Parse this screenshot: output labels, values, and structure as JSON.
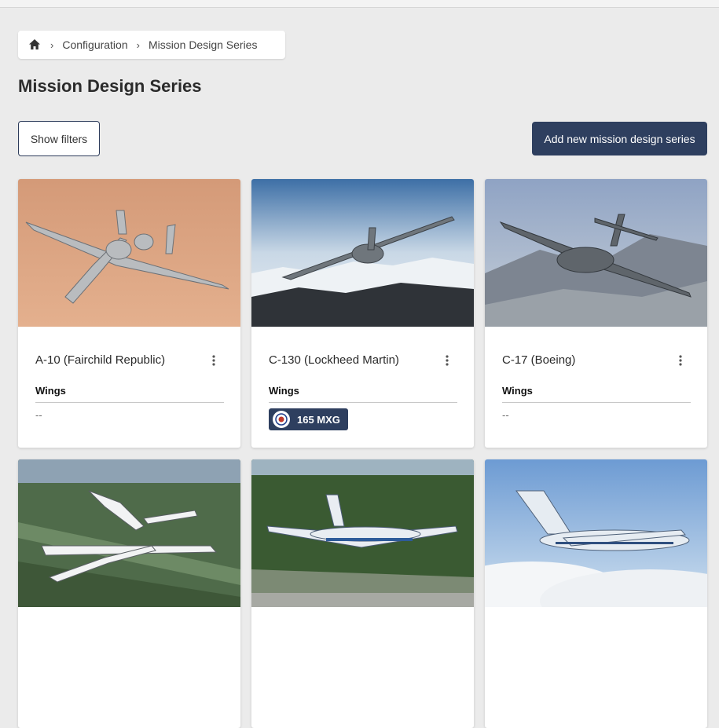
{
  "breadcrumb": {
    "items": [
      "Configuration",
      "Mission Design Series"
    ]
  },
  "page": {
    "title": "Mission Design Series",
    "show_filters_label": "Show filters",
    "add_label": "Add new mission design series"
  },
  "cards": [
    {
      "name": "A-10 (Fairchild Republic)",
      "wings_label": "Wings",
      "wings_empty": "--"
    },
    {
      "name": "C-130 (Lockheed Martin)",
      "wings_label": "Wings",
      "wing_badge": "165 MXG"
    },
    {
      "name": "C-17 (Boeing)",
      "wings_label": "Wings",
      "wings_empty": "--"
    },
    {
      "name": ""
    },
    {
      "name": ""
    },
    {
      "name": ""
    }
  ],
  "colors": {
    "primary": "#2e3f5f",
    "background": "#ebebeb"
  }
}
